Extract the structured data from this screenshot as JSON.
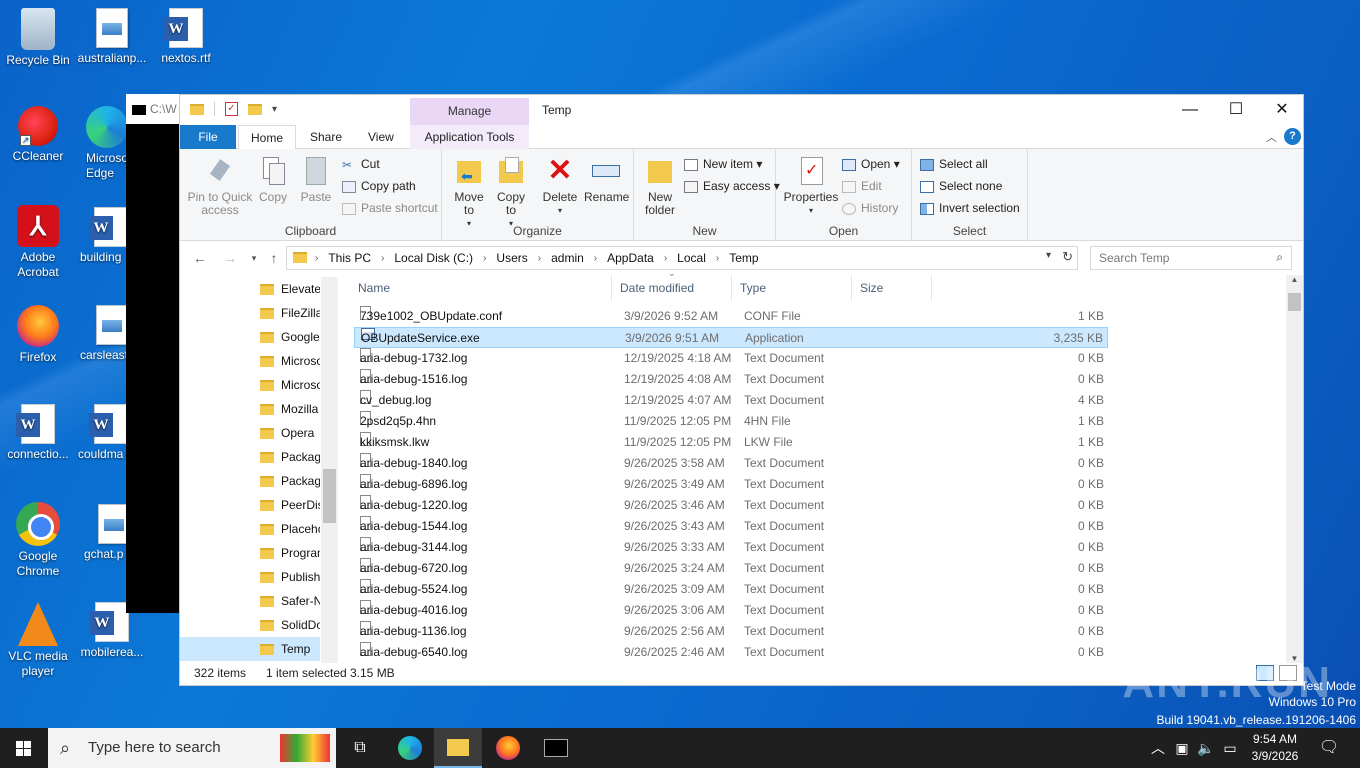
{
  "desktop": {
    "icons": [
      {
        "label": "Recycle Bin",
        "icon": "recycle-bin-icon"
      },
      {
        "label": "australianp...",
        "icon": "image-file-icon"
      },
      {
        "label": "nextos.rtf",
        "icon": "word-document-icon"
      },
      {
        "label": "CCleaner",
        "icon": "ccleaner-icon"
      },
      {
        "label": "Microsoft Edge",
        "icon": "edge-icon"
      },
      {
        "label": "Adobe Acrobat",
        "icon": "acrobat-icon"
      },
      {
        "label": "building",
        "icon": "word-document-icon"
      },
      {
        "label": "Firefox",
        "icon": "firefox-icon"
      },
      {
        "label": "carsleast",
        "icon": "image-file-icon"
      },
      {
        "label": "connectio...",
        "icon": "word-document-icon"
      },
      {
        "label": "couldma",
        "icon": "word-document-icon"
      },
      {
        "label": "Google Chrome",
        "icon": "chrome-icon"
      },
      {
        "label": "gchat.p",
        "icon": "image-file-icon"
      },
      {
        "label": "VLC media player",
        "icon": "vlc-icon"
      },
      {
        "label": "mobilerea...",
        "icon": "word-document-icon"
      }
    ]
  },
  "console": {
    "title": "C:\\W"
  },
  "explorer": {
    "title": "Temp",
    "manage_tab": "Manage",
    "tabs": {
      "file": "File",
      "home": "Home",
      "share": "Share",
      "view": "View",
      "app_tools": "Application Tools"
    },
    "ribbon": {
      "clipboard": {
        "label": "Clipboard",
        "pin": "Pin to Quick access",
        "copy": "Copy",
        "paste": "Paste",
        "cut": "Cut",
        "copy_path": "Copy path",
        "paste_shortcut": "Paste shortcut"
      },
      "organize": {
        "label": "Organize",
        "move_to": "Move to",
        "copy_to": "Copy to",
        "delete": "Delete",
        "rename": "Rename"
      },
      "new": {
        "label": "New",
        "new_folder": "New folder",
        "new_item": "New item",
        "easy_access": "Easy access"
      },
      "open": {
        "label": "Open",
        "properties": "Properties",
        "open": "Open",
        "edit": "Edit",
        "history": "History"
      },
      "select": {
        "label": "Select",
        "select_all": "Select all",
        "select_none": "Select none",
        "invert": "Invert selection"
      }
    },
    "address": {
      "crumbs": [
        "This PC",
        "Local Disk (C:)",
        "Users",
        "admin",
        "AppData",
        "Local",
        "Temp"
      ]
    },
    "search": {
      "placeholder": "Search Temp"
    },
    "nav_items": [
      "Elevate",
      "FileZilla",
      "Google",
      "Microso",
      "Microso",
      "Mozilla",
      "Opera",
      "Packag",
      "Packag",
      "PeerDis",
      "Placeho",
      "Program",
      "Publish",
      "Safer-N",
      "SolidDo",
      "Temp"
    ],
    "columns": {
      "name": "Name",
      "date": "Date modified",
      "type": "Type",
      "size": "Size"
    },
    "files": [
      {
        "name": "739e1002_OBUpdate.conf",
        "date": "3/9/2026 9:52 AM",
        "type": "CONF File",
        "size": "1 KB"
      },
      {
        "name": "OBUpdateService.exe",
        "date": "3/9/2026 9:51 AM",
        "type": "Application",
        "size": "3,235 KB"
      },
      {
        "name": "aria-debug-1732.log",
        "date": "12/19/2025 4:18 AM",
        "type": "Text Document",
        "size": "0 KB"
      },
      {
        "name": "aria-debug-1516.log",
        "date": "12/19/2025 4:08 AM",
        "type": "Text Document",
        "size": "0 KB"
      },
      {
        "name": "cv_debug.log",
        "date": "12/19/2025 4:07 AM",
        "type": "Text Document",
        "size": "4 KB"
      },
      {
        "name": "2psd2q5p.4hn",
        "date": "11/9/2025 12:05 PM",
        "type": "4HN File",
        "size": "1 KB"
      },
      {
        "name": "kkiksmsk.lkw",
        "date": "11/9/2025 12:05 PM",
        "type": "LKW File",
        "size": "1 KB"
      },
      {
        "name": "aria-debug-1840.log",
        "date": "9/26/2025 3:58 AM",
        "type": "Text Document",
        "size": "0 KB"
      },
      {
        "name": "aria-debug-6896.log",
        "date": "9/26/2025 3:49 AM",
        "type": "Text Document",
        "size": "0 KB"
      },
      {
        "name": "aria-debug-1220.log",
        "date": "9/26/2025 3:46 AM",
        "type": "Text Document",
        "size": "0 KB"
      },
      {
        "name": "aria-debug-1544.log",
        "date": "9/26/2025 3:43 AM",
        "type": "Text Document",
        "size": "0 KB"
      },
      {
        "name": "aria-debug-3144.log",
        "date": "9/26/2025 3:33 AM",
        "type": "Text Document",
        "size": "0 KB"
      },
      {
        "name": "aria-debug-6720.log",
        "date": "9/26/2025 3:24 AM",
        "type": "Text Document",
        "size": "0 KB"
      },
      {
        "name": "aria-debug-5524.log",
        "date": "9/26/2025 3:09 AM",
        "type": "Text Document",
        "size": "0 KB"
      },
      {
        "name": "aria-debug-4016.log",
        "date": "9/26/2025 3:06 AM",
        "type": "Text Document",
        "size": "0 KB"
      },
      {
        "name": "aria-debug-1136.log",
        "date": "9/26/2025 2:56 AM",
        "type": "Text Document",
        "size": "0 KB"
      },
      {
        "name": "aria-debug-6540.log",
        "date": "9/26/2025 2:46 AM",
        "type": "Text Document",
        "size": "0 KB"
      }
    ],
    "selected_index": 1,
    "status": {
      "count": "322 items",
      "selection": "1 item selected",
      "size": "3.15 MB"
    }
  },
  "watermark": "ANY.RUN",
  "test_mode": {
    "line1": "Test Mode",
    "line2": "Windows 10 Pro",
    "line3": "Build 19041.vb_release.191206-1406"
  },
  "taskbar": {
    "search_placeholder": "Type here to search",
    "time": "9:54 AM",
    "date": "3/9/2026"
  }
}
